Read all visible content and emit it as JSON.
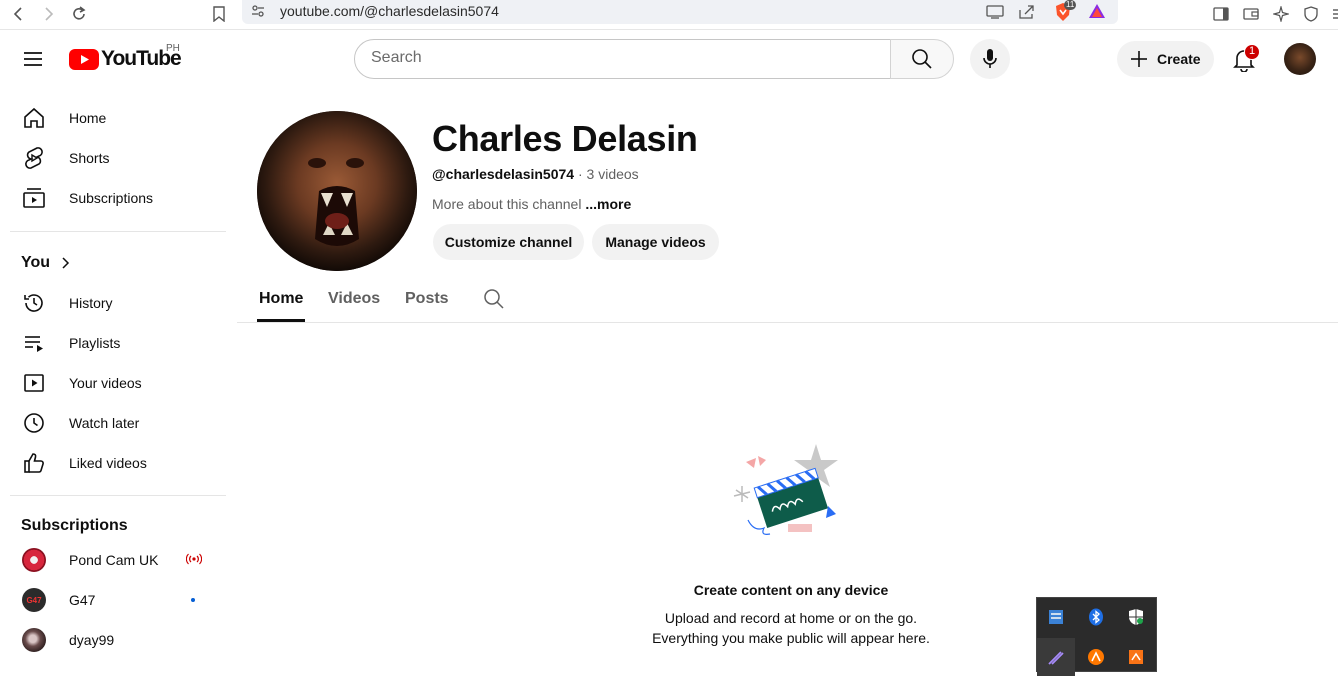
{
  "browser": {
    "url": "youtube.com/@charlesdelasin5074",
    "brave_badge": "11"
  },
  "header": {
    "logo_text": "YouTube",
    "region": "PH",
    "search_placeholder": "Search",
    "create_label": "Create",
    "notifications_count": "1"
  },
  "sidebar": {
    "main": [
      {
        "label": "Home",
        "icon": "home-icon"
      },
      {
        "label": "Shorts",
        "icon": "shorts-icon"
      },
      {
        "label": "Subscriptions",
        "icon": "subscriptions-icon"
      }
    ],
    "you_heading": "You",
    "you_items": [
      {
        "label": "History",
        "icon": "history-icon"
      },
      {
        "label": "Playlists",
        "icon": "playlists-icon"
      },
      {
        "label": "Your videos",
        "icon": "your-videos-icon"
      },
      {
        "label": "Watch later",
        "icon": "watch-later-icon"
      },
      {
        "label": "Liked videos",
        "icon": "liked-videos-icon"
      }
    ],
    "subscriptions_heading": "Subscriptions",
    "subscriptions": [
      {
        "label": "Pond Cam UK",
        "indicator": "live"
      },
      {
        "label": "G47",
        "indicator": "new",
        "avatar_text": "G47"
      },
      {
        "label": "dyay99",
        "indicator": ""
      }
    ]
  },
  "channel": {
    "name": "Charles Delasin",
    "handle": "@charlesdelasin5074",
    "video_count": "3 videos",
    "about": "More about this channel",
    "more": "...more",
    "customize_label": "Customize channel",
    "manage_label": "Manage videos"
  },
  "tabs": [
    {
      "label": "Home",
      "active": true
    },
    {
      "label": "Videos",
      "active": false
    },
    {
      "label": "Posts",
      "active": false
    }
  ],
  "empty_state": {
    "title": "Create content on any device",
    "line1": "Upload and record at home or on the go.",
    "line2": "Everything you make public will appear here."
  },
  "colors": {
    "youtube_red": "#ff0000",
    "badge_red": "#cc0000",
    "text_primary": "#0f0f0f",
    "text_secondary": "#606060"
  }
}
